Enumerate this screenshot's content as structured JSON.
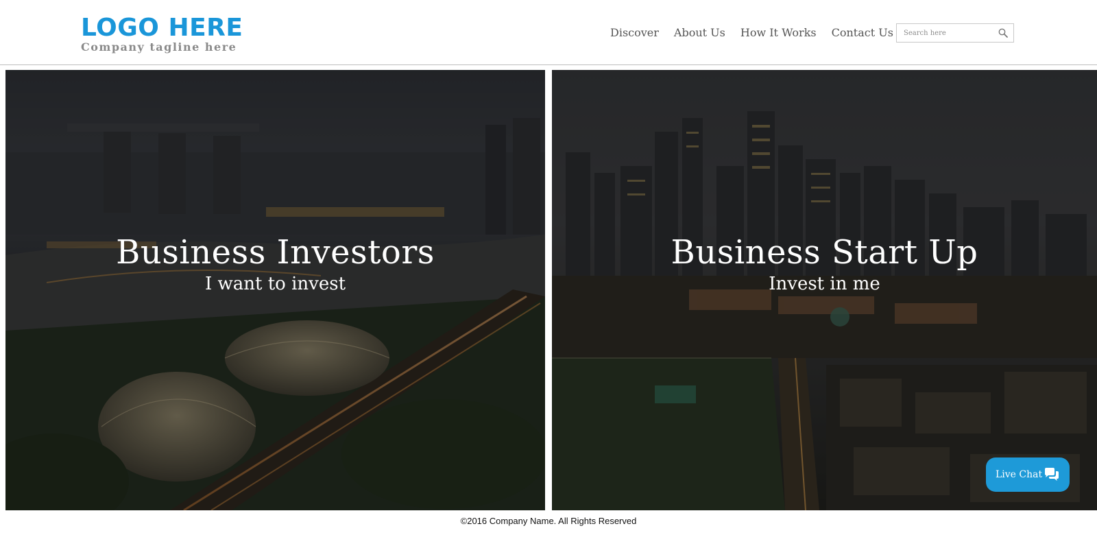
{
  "brand": {
    "logo_text": "LOGO HERE",
    "tagline": "Company tagline here",
    "logo_color": "#1a96d9"
  },
  "nav": {
    "items": [
      {
        "label": "Discover"
      },
      {
        "label": "About Us"
      },
      {
        "label": "How It Works"
      },
      {
        "label": "Contact Us"
      }
    ]
  },
  "search": {
    "placeholder": "Search here",
    "icon": "magnifier-icon"
  },
  "panels": [
    {
      "title": "Business Investors",
      "subtitle": "I want to invest"
    },
    {
      "title": "Business Start Up",
      "subtitle": "Invest in me"
    }
  ],
  "live_chat": {
    "label": "Live Chat",
    "icon": "chat-bubbles-icon",
    "color": "#1e9ad8"
  },
  "footer": {
    "copyright": "©2016 Company Name. All Rights Reserved"
  }
}
